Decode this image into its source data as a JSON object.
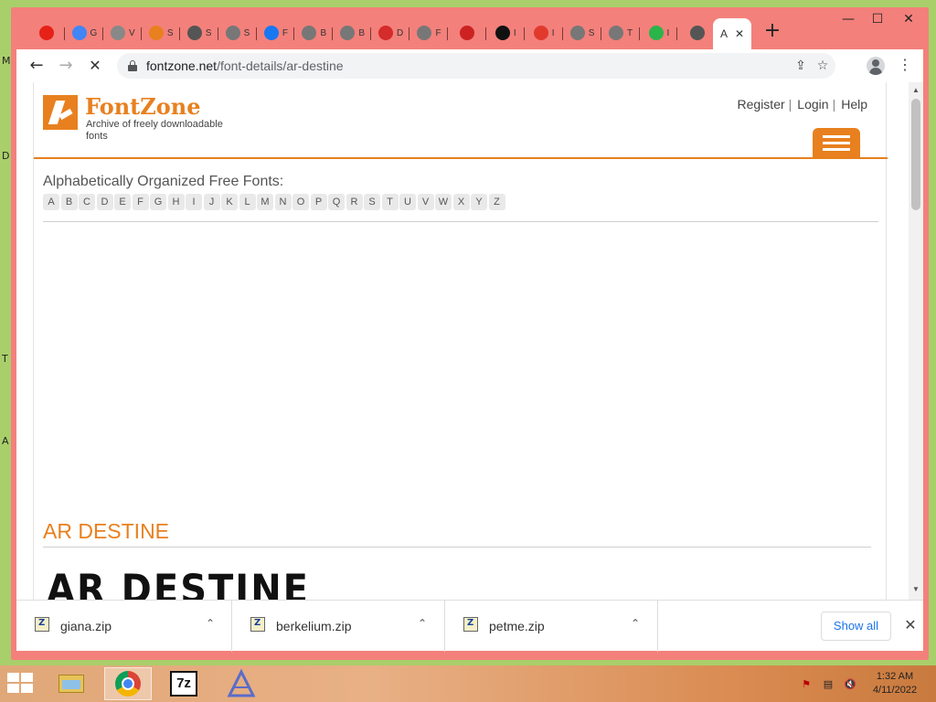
{
  "desktop": {
    "side_letters": [
      "M",
      "D",
      "T",
      "A"
    ]
  },
  "browser": {
    "tabs": [
      {
        "icon": "youtube-icon",
        "letter": "",
        "color": "#e62117"
      },
      {
        "icon": "google-icon",
        "letter": "G",
        "color": "#4285f4"
      },
      {
        "icon": "cloud-icon",
        "letter": "V",
        "color": "#888888"
      },
      {
        "icon": "swirl-icon",
        "letter": "S",
        "color": "#e8801f"
      },
      {
        "icon": "cloud-icon",
        "letter": "S",
        "color": "#555555"
      },
      {
        "icon": "globe-icon",
        "letter": "S",
        "color": "#777777"
      },
      {
        "icon": "facebook-icon",
        "letter": "F",
        "color": "#1877f2"
      },
      {
        "icon": "globe-icon",
        "letter": "B",
        "color": "#777777"
      },
      {
        "icon": "globe-icon",
        "letter": "B",
        "color": "#777777"
      },
      {
        "icon": "d-icon",
        "letter": "D",
        "color": "#d42b2b"
      },
      {
        "icon": "globe-icon",
        "letter": "F",
        "color": "#777777"
      },
      {
        "icon": "font-icon",
        "letter": "",
        "color": "#cc2222"
      },
      {
        "icon": "dark-circle-icon",
        "letter": "I",
        "color": "#111111"
      },
      {
        "icon": "italic-f-icon",
        "letter": "I",
        "color": "#e03a2d"
      },
      {
        "icon": "globe-icon",
        "letter": "S",
        "color": "#777777"
      },
      {
        "icon": "globe-icon",
        "letter": "T",
        "color": "#777777"
      },
      {
        "icon": "fi-icon",
        "letter": "I",
        "color": "#2bb44a"
      },
      {
        "icon": "chrome-circle-icon",
        "letter": "",
        "color": "#555555"
      }
    ],
    "active_tab": {
      "title": "A",
      "close": "✕"
    },
    "new_tab": "+",
    "window_controls": {
      "minimize": "—",
      "maximize": "☐",
      "close": "✕"
    },
    "nav": {
      "back": "←",
      "forward": "→",
      "stop": "✕"
    },
    "address": {
      "host": "fontzone.net",
      "path": "/font-details/ar-destine"
    },
    "omnibox_icons": {
      "share": "⇪",
      "star": "☆"
    },
    "menu": "⋮"
  },
  "page": {
    "brand": "FontZone",
    "tagline": "Archive of freely downloadable fonts",
    "top_links": [
      "Register",
      "Login",
      "Help"
    ],
    "link_separator": "|",
    "alpha_title": "Alphabetically Organized Free Fonts:",
    "letters": [
      "A",
      "B",
      "C",
      "D",
      "E",
      "F",
      "G",
      "H",
      "I",
      "J",
      "K",
      "L",
      "M",
      "N",
      "O",
      "P",
      "Q",
      "R",
      "S",
      "T",
      "U",
      "V",
      "W",
      "X",
      "Y",
      "Z"
    ],
    "font_name": "AR DESTINE",
    "preview_text": "AR DESTINE",
    "accent": "#e8801f"
  },
  "downloads": {
    "items": [
      {
        "name": "giana.zip",
        "chevron": "⌃"
      },
      {
        "name": "berkelium.zip",
        "chevron": "⌃"
      },
      {
        "name": "petme.zip",
        "chevron": "⌃"
      }
    ],
    "show_all": "Show all",
    "close": "✕"
  },
  "taskbar": {
    "apps": [
      "file-explorer-icon",
      "chrome-icon",
      "7zip-icon",
      "font-app-icon"
    ],
    "app_7z_label": "7z",
    "tray": {
      "flag": "⚑",
      "network": "▤",
      "volume": "🔇"
    },
    "time": "1:32 AM",
    "date": "4/11/2022"
  }
}
